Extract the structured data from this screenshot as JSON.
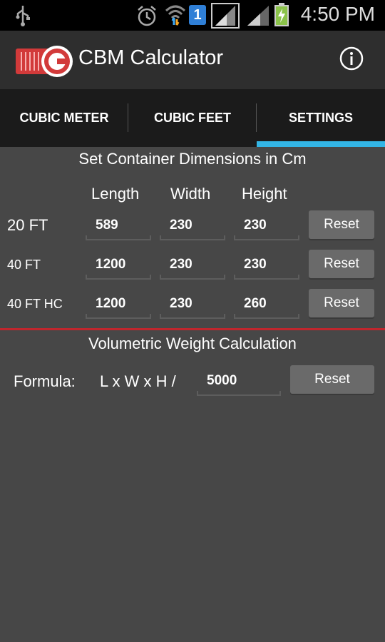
{
  "status": {
    "time": "4:50 PM",
    "sim_badge": "1"
  },
  "app": {
    "title": "CBM Calculator"
  },
  "tabs": [
    {
      "label": "CUBIC METER",
      "active": false
    },
    {
      "label": "CUBIC FEET",
      "active": false
    },
    {
      "label": "SETTINGS",
      "active": true
    }
  ],
  "containers": {
    "title": "Set Container Dimensions in Cm",
    "columns": {
      "length": "Length",
      "width": "Width",
      "height": "Height"
    },
    "rows": [
      {
        "label": "20 FT",
        "length": "589",
        "width": "230",
        "height": "230",
        "reset": "Reset"
      },
      {
        "label": "40 FT",
        "length": "1200",
        "width": "230",
        "height": "230",
        "reset": "Reset"
      },
      {
        "label": "40 FT HC",
        "length": "1200",
        "width": "230",
        "height": "260",
        "reset": "Reset"
      }
    ]
  },
  "volumetric": {
    "title": "Volumetric Weight Calculation",
    "formula_label": "Formula:",
    "formula_expr": "L x W x H /",
    "divisor": "5000",
    "reset": "Reset"
  },
  "colors": {
    "accent": "#33b5e5",
    "divider": "#c0262d",
    "background": "#474747"
  }
}
